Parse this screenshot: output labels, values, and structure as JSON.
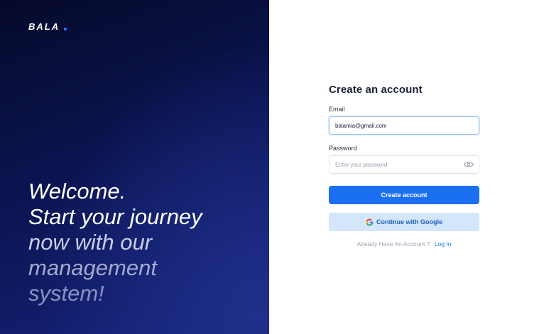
{
  "brand": {
    "name": "BALA",
    "accent_color": "#2a7bff",
    "panel_colors": [
      "#050a2a",
      "#15237a"
    ]
  },
  "hero": {
    "lines": [
      "Welcome.",
      "Start your journey",
      "now with our",
      "management",
      "system!"
    ]
  },
  "form": {
    "title": "Create an account",
    "email": {
      "label": "Email",
      "value": "balamia@gmail.com"
    },
    "password": {
      "label": "Password",
      "placeholder": "Enter your password",
      "toggle_icon": "eye-icon"
    },
    "primary_button": {
      "label": "Create account",
      "color": "#1b6ff1"
    },
    "google_button": {
      "label": "Continue with Google",
      "icon": "google-icon",
      "color": "#d4e6fb"
    },
    "login_prompt": {
      "question": "Already Have An Account ?",
      "link": "Log In"
    }
  }
}
